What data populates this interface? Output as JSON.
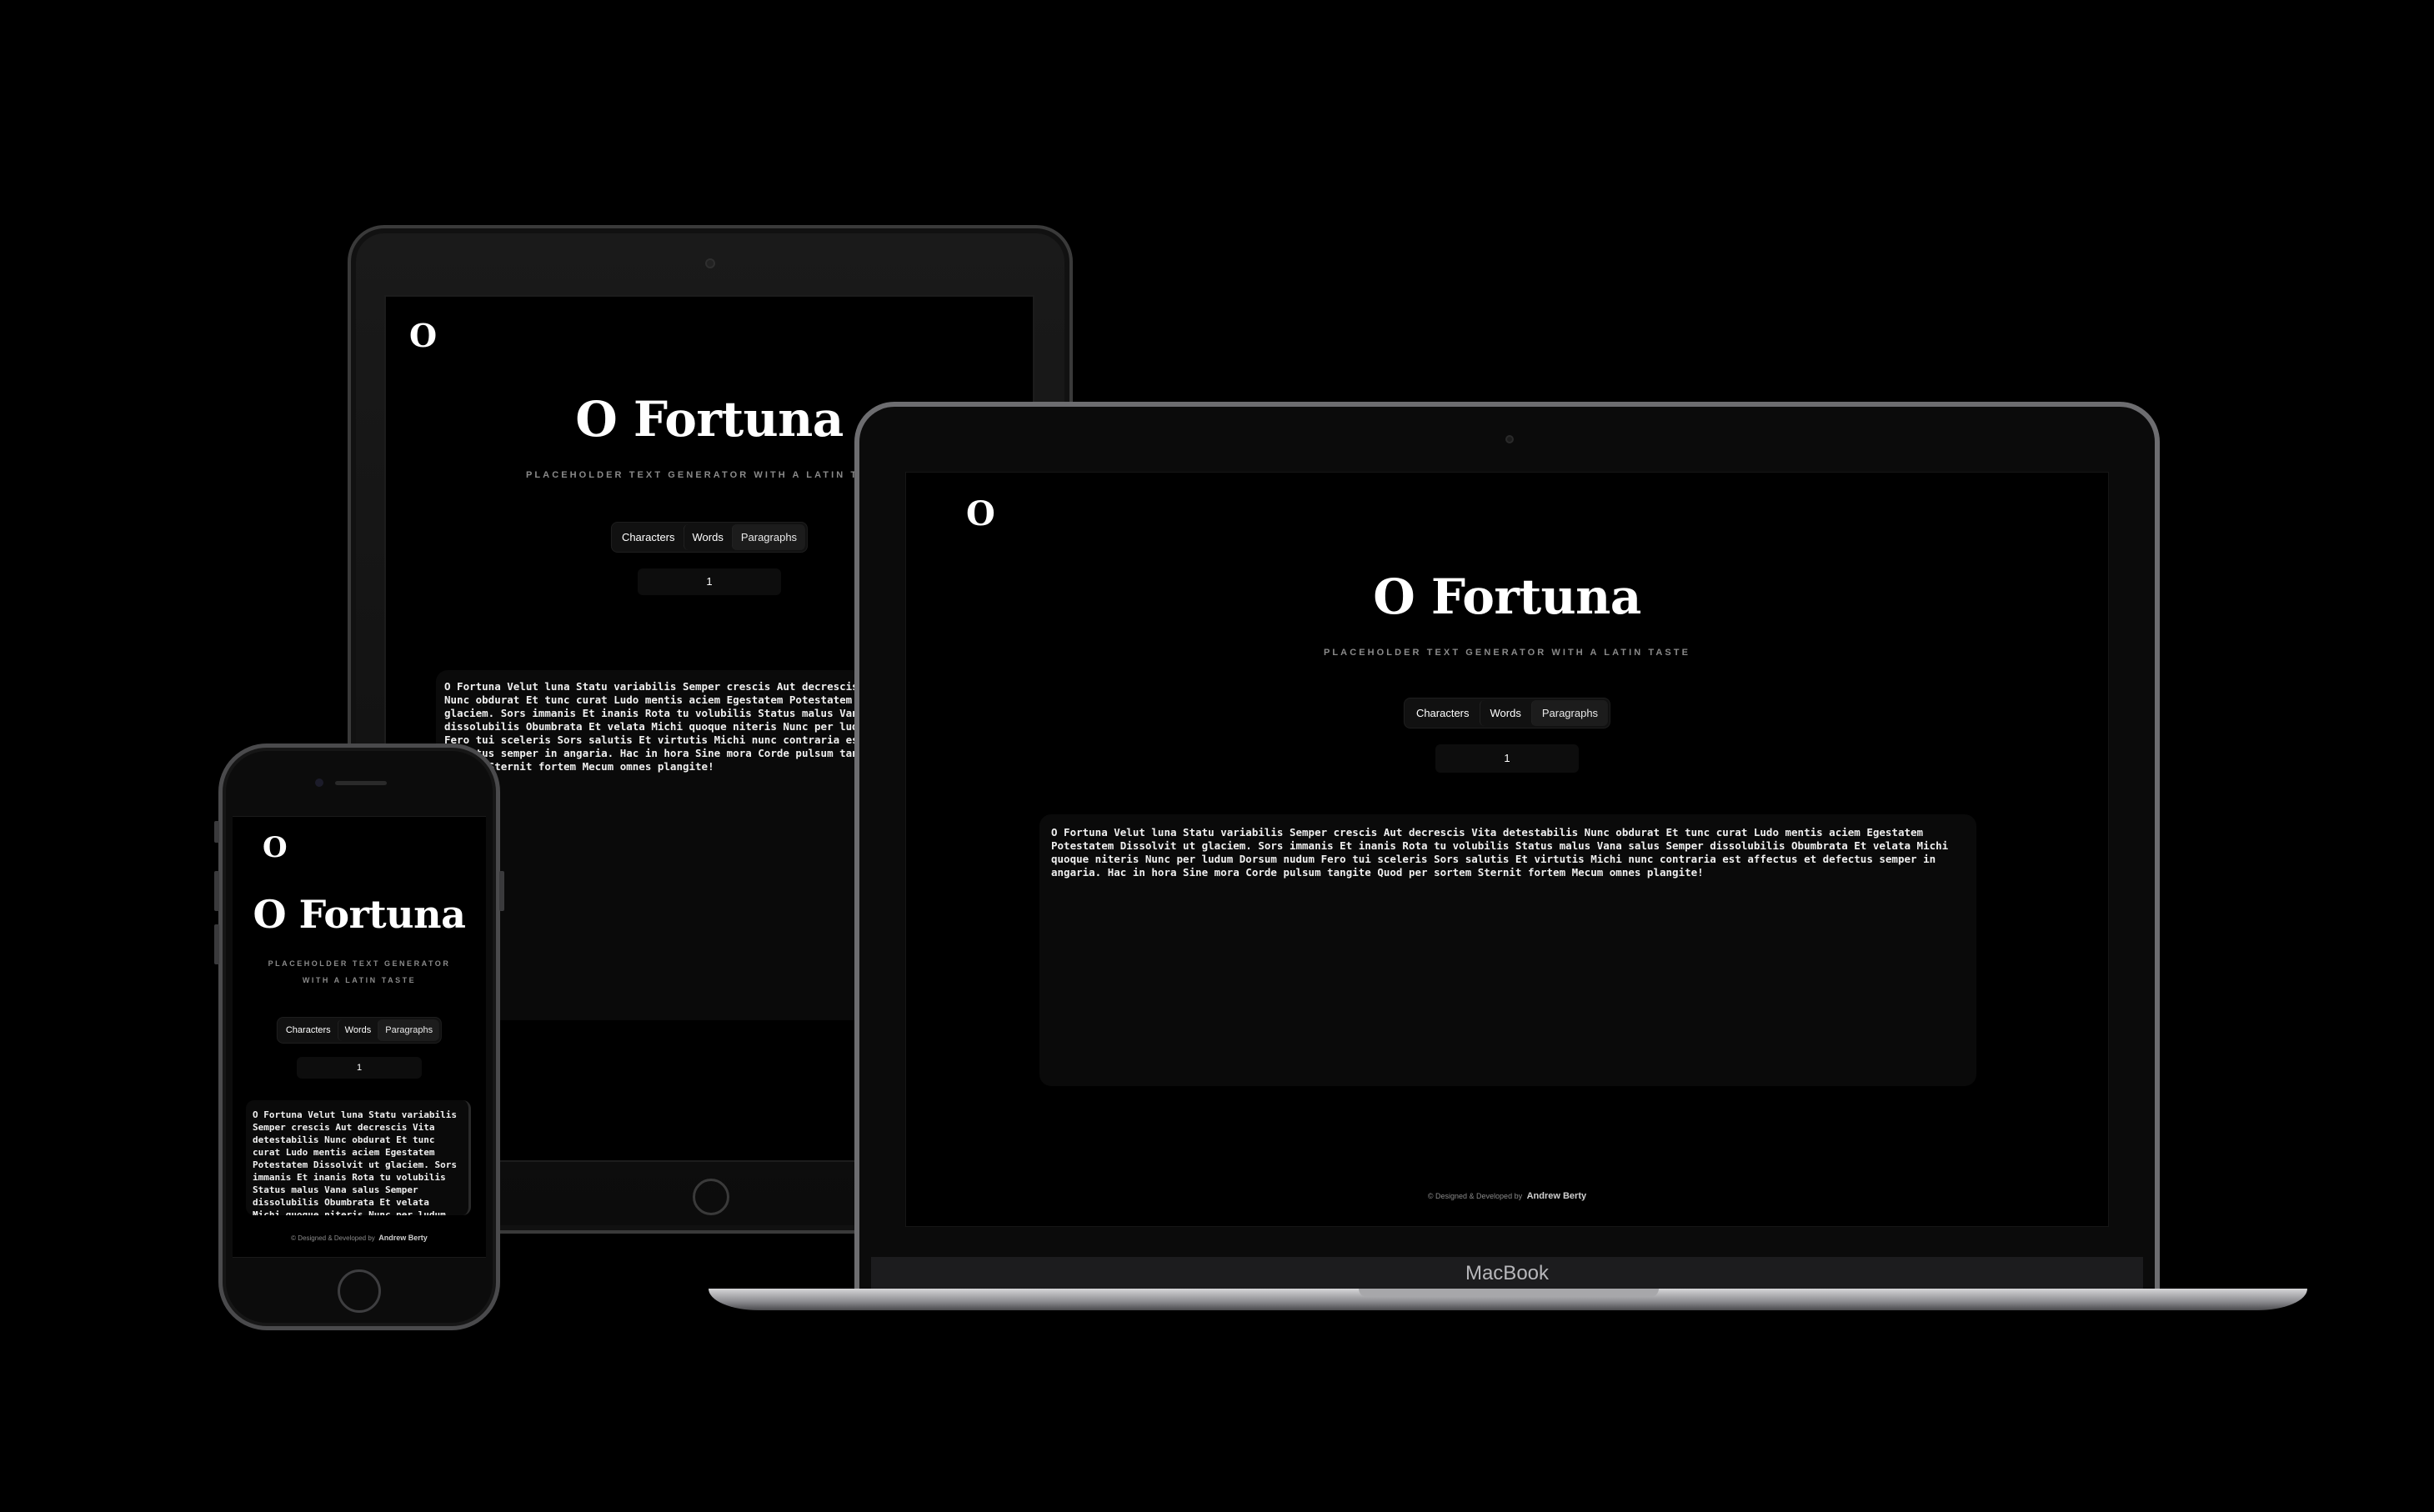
{
  "app": {
    "logo": "O",
    "title": "O Fortuna",
    "subtitle": "PLACEHOLDER TEXT GENERATOR WITH A LATIN TASTE",
    "tabs": [
      {
        "label": "Characters",
        "active": false
      },
      {
        "label": "Words",
        "active": false
      },
      {
        "label": "Paragraphs",
        "active": true
      }
    ],
    "count_value": "1",
    "generated_text": "O Fortuna Velut luna Statu variabilis Semper crescis Aut decrescis Vita detestabilis Nunc obdurat Et tunc curat Ludo mentis aciem Egestatem Potestatem Dissolvit ut glaciem. Sors immanis Et inanis Rota tu volubilis Status malus Vana salus Semper dissolubilis Obumbrata Et velata Michi quoque niteris Nunc per ludum Dorsum nudum Fero tui sceleris Sors salutis Et virtutis Michi nunc contraria est affectus et defectus semper in angaria. Hac in hora Sine mora Corde pulsum tangite Quod per sortem Sternit fortem Mecum omnes plangite!",
    "footer_prefix": "© Designed & Developed by",
    "footer_author": "Andrew Berty"
  },
  "devices": {
    "laptop_brand": "MacBook"
  },
  "colors": {
    "background": "#000000",
    "text": "#ffffff",
    "muted": "#8a8a8a",
    "panel": "#0a0a0a"
  }
}
